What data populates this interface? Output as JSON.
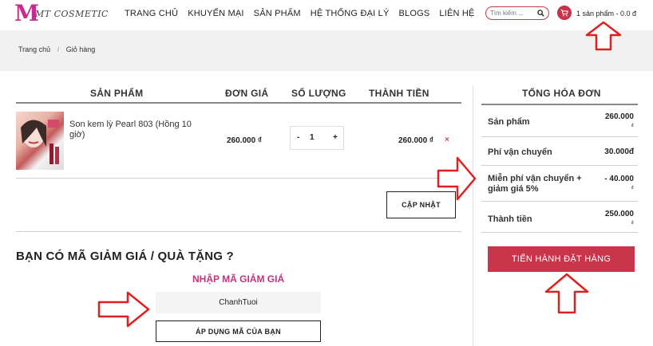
{
  "header": {
    "logo_letter": "M",
    "logo_text": "MT COSMETIC",
    "nav": [
      "TRANG CHỦ",
      "KHUYẾN MẠI",
      "SẢN PHẨM",
      "HỆ THỐNG ĐẠI LÝ",
      "BLOGS",
      "LIÊN HỆ"
    ],
    "search_placeholder": "Tìm kiếm ...",
    "cart_summary": "1 sản phẩm - 0.0 đ"
  },
  "breadcrumb": [
    "Trang chủ",
    "Giỏ hàng"
  ],
  "breadcrumb_sep": "/",
  "cart": {
    "headers": {
      "product": "SẢN PHẨM",
      "unit_price": "ĐƠN GIÁ",
      "quantity": "SỐ LƯỢNG",
      "total": "THÀNH TIỀN"
    },
    "item": {
      "name": "Son kem lỳ Pearl 803 (Hồng 10 giờ)",
      "unit_price": "260.000 ₫",
      "qty_minus": "-",
      "qty_value": "1",
      "qty_plus": "+",
      "line_total": "260.000 ₫",
      "remove": "×"
    },
    "update_label": "CẬP NHẬT"
  },
  "coupon": {
    "title": "BẠN CÓ MÃ GIẢM GIÁ / QUÀ TẶNG ?",
    "subtitle": "NHẬP MÃ GIẢM GIÁ",
    "input_value": "ChanhTuoi",
    "apply_label": "ÁP DỤNG MÃ CỦA BẠN"
  },
  "summary": {
    "title": "TỔNG HÓA ĐƠN",
    "rows": [
      {
        "label": "Sản phẩm",
        "value": "260.000",
        "currency": "₫"
      },
      {
        "label": "Phí vận chuyển",
        "value": "30.000đ",
        "currency": ""
      },
      {
        "label": "Miễn phí vận chuyển + giảm giá 5%",
        "value": "- 40.000",
        "currency": "₫"
      },
      {
        "label": "Thành tiền",
        "value": "250.000",
        "currency": "₫"
      }
    ],
    "checkout_label": "TIẾN HÀNH ĐẶT HÀNG"
  },
  "colors": {
    "accent": "#c8354b",
    "brand_pink": "#c92a8e",
    "annotation_red": "#e02020"
  }
}
